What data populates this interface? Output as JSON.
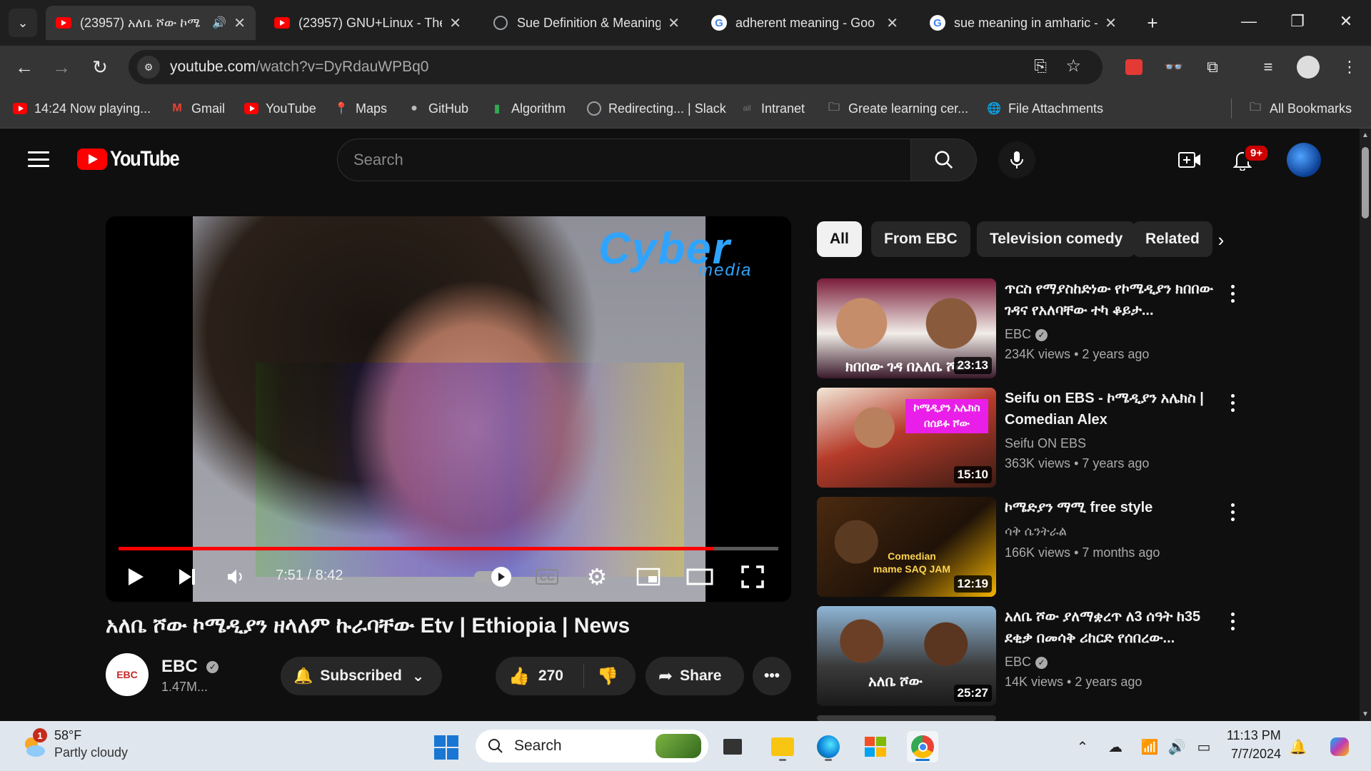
{
  "browser": {
    "tabs": [
      {
        "title": "(23957) አለቤ ሾው ኮሜ",
        "favicon": "youtube-icon",
        "active": true,
        "audio": true
      },
      {
        "title": "(23957) GNU+Linux - The",
        "favicon": "youtube-icon",
        "active": false
      },
      {
        "title": "Sue Definition & Meaning",
        "favicon": "globe-icon",
        "active": false
      },
      {
        "title": "adherent meaning - Goo",
        "favicon": "google-icon",
        "active": false
      },
      {
        "title": "sue meaning in amharic -",
        "favicon": "google-icon",
        "active": false
      }
    ],
    "url_host": "youtube.com",
    "url_path": "/watch?v=DyRdauWPBq0",
    "bookmarks": [
      {
        "label": "14:24 Now playing...",
        "icon": "youtube-icon"
      },
      {
        "label": "Gmail",
        "icon": "gmail-icon"
      },
      {
        "label": "YouTube",
        "icon": "youtube-icon"
      },
      {
        "label": "Maps",
        "icon": "maps-icon"
      },
      {
        "label": "GitHub",
        "icon": "github-icon"
      },
      {
        "label": "Algorithm",
        "icon": "bookmark-icon"
      },
      {
        "label": "Redirecting... | Slack",
        "icon": "globe-icon"
      },
      {
        "label": "Intranet",
        "icon": "intranet-icon"
      },
      {
        "label": "Greate learning cer...",
        "icon": "folder-icon"
      },
      {
        "label": "File Attachments",
        "icon": "globe-icon"
      }
    ],
    "all_bookmarks": "All Bookmarks"
  },
  "youtube": {
    "logo_text": "YouTube",
    "search_placeholder": "Search",
    "notification_count": "9+",
    "player": {
      "time": "7:51 / 8:42",
      "progress": 0.903,
      "watermark": "Cyber",
      "watermark_sub": "media"
    },
    "video_title": "አለቤ ሾው ኮሜዲያን ዘላለም ኩራባቸው Etv | Ethiopia | News",
    "channel": {
      "name": "EBC",
      "subscribers": "1.47M...",
      "avatar_text": "EBC"
    },
    "subscribed_label": "Subscribed",
    "likes": "270",
    "share_label": "Share",
    "chips": [
      "All",
      "From EBC",
      "Television comedy",
      "Related"
    ],
    "recommendations": [
      {
        "title": "ጥርስ የማያስከድነው የኮሜዲያን ክበበው ገዳና የአለባቸው ተካ ቆይታ...",
        "channel": "EBC",
        "verified": true,
        "views": "234K views",
        "age": "2 years ago",
        "duration": "23:13",
        "thumb_text": "ክበበው ገዳ በአለቤ ሾው"
      },
      {
        "title": "Seifu on EBS - ኮሜዲያን አሌክስ | Comedian Alex",
        "channel": "Seifu ON EBS",
        "verified": false,
        "views": "363K views",
        "age": "7 years ago",
        "duration": "15:10",
        "thumb_text": "ኮሜዲያን አሌክስ በሰይፉ ሾው"
      },
      {
        "title": "ኮሜድያን ማሚ free style",
        "channel": "ሳቅ ሴንትራል",
        "verified": false,
        "views": "166K views",
        "age": "7 months ago",
        "duration": "12:19",
        "thumb_text": "Comedian mame SAQ JAM"
      },
      {
        "title": "አለቤ ሾው ያለማቋረጥ ለ3 ሰዓት ከ35 ደቂቃ በመሳቅ ሪከርድ የሰበረው...",
        "channel": "EBC",
        "verified": true,
        "views": "14K views",
        "age": "2 years ago",
        "duration": "25:27",
        "thumb_text": "አለቤ ሾው"
      }
    ]
  },
  "taskbar": {
    "temperature": "58°F",
    "condition": "Partly cloudy",
    "weather_badge": "1",
    "search_label": "Search",
    "time": "11:13 PM",
    "date": "7/7/2024"
  }
}
